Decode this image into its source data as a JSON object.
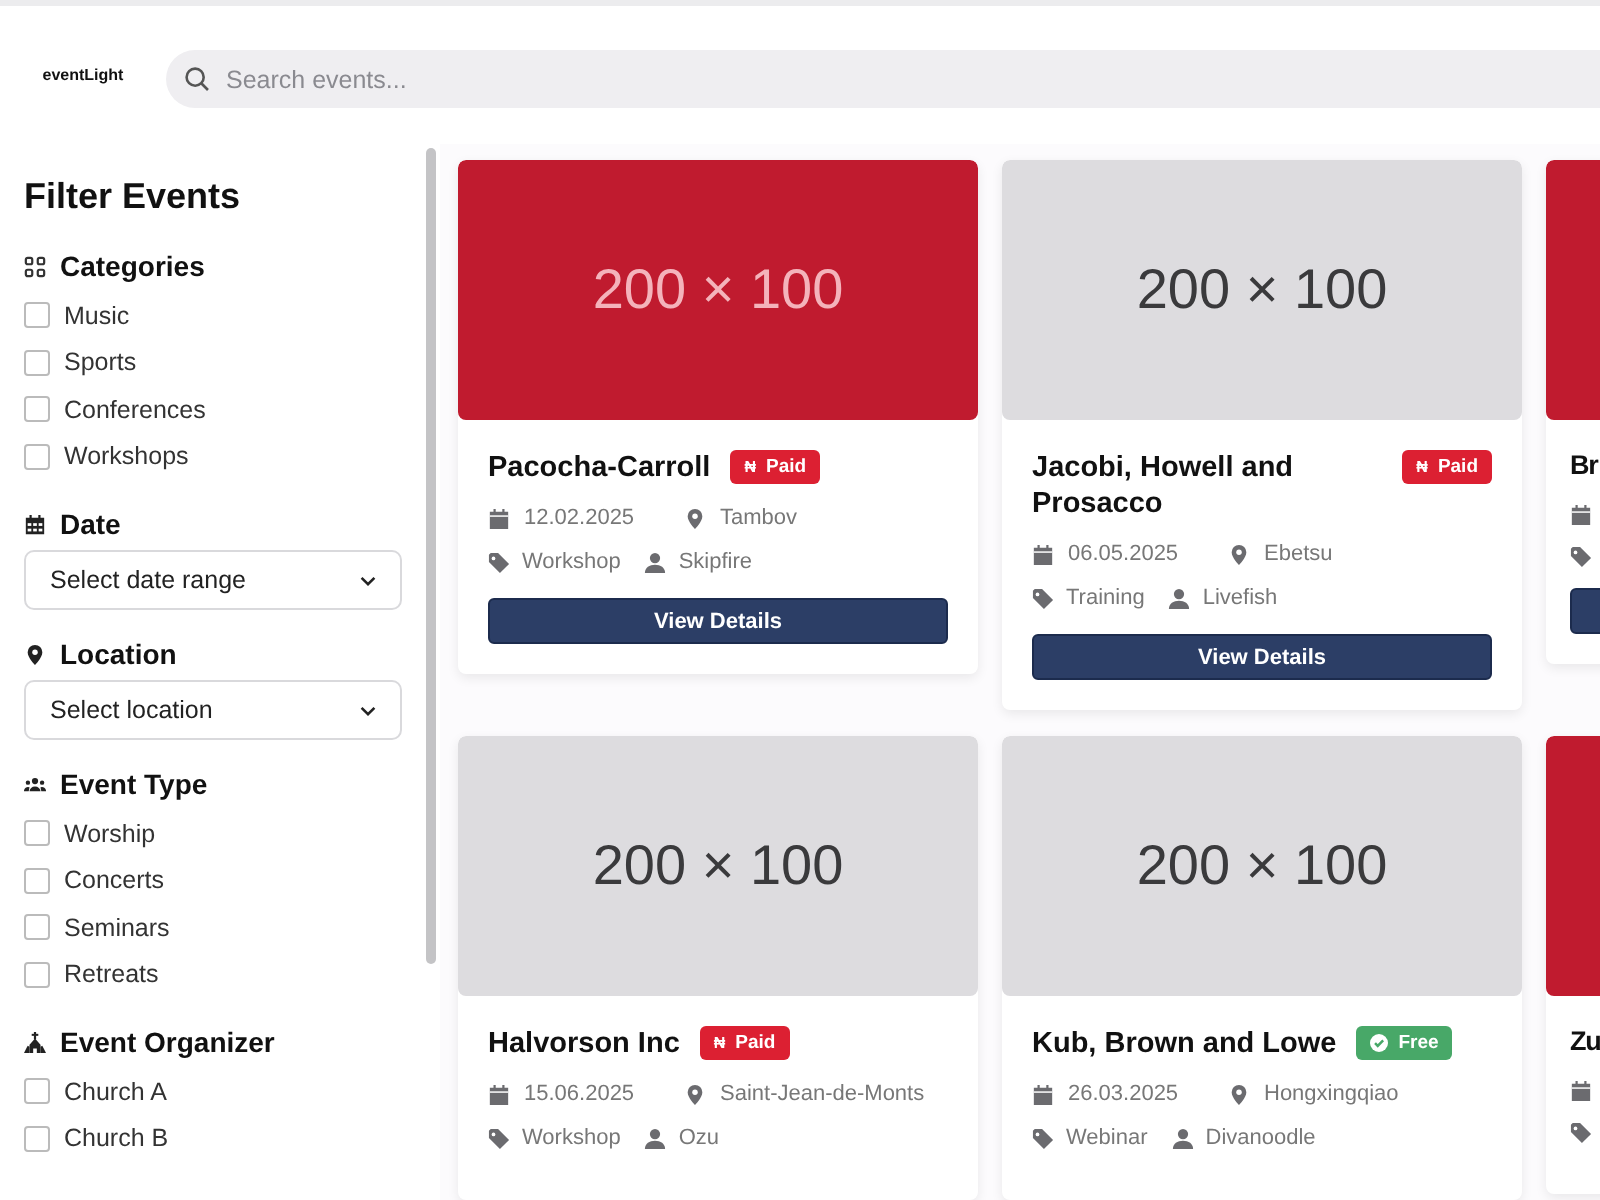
{
  "header": {
    "logo": "eventLight",
    "search": {
      "placeholder": "Search events..."
    }
  },
  "sidebar": {
    "title": "Filter Events",
    "sections": [
      {
        "kind": "checkboxes",
        "title": "Categories",
        "options": [
          {
            "label": "Music",
            "checked": false
          },
          {
            "label": "Sports",
            "checked": false
          },
          {
            "label": "Conferences",
            "checked": false
          },
          {
            "label": "Workshops",
            "checked": false
          }
        ]
      },
      {
        "kind": "select",
        "title": "Date",
        "placeholder": "Select date range"
      },
      {
        "kind": "select",
        "title": "Location",
        "placeholder": "Select location"
      },
      {
        "kind": "checkboxes",
        "title": "Event Type",
        "options": [
          {
            "label": "Worship",
            "checked": false
          },
          {
            "label": "Concerts",
            "checked": false
          },
          {
            "label": "Seminars",
            "checked": false
          },
          {
            "label": "Retreats",
            "checked": false
          }
        ]
      },
      {
        "kind": "checkboxes",
        "title": "Event Organizer",
        "options": [
          {
            "label": "Church A",
            "checked": false
          },
          {
            "label": "Church B",
            "checked": false
          }
        ]
      }
    ]
  },
  "events": [
    {
      "kind": "full",
      "image": {
        "label": "200 × 100",
        "color": "#c01b2f"
      },
      "title": "Pacocha-Carroll",
      "badge": {
        "kind": "paid",
        "symbol": "₦",
        "label": "Paid",
        "color": "#dc2032"
      },
      "date": "12.02.2025",
      "location": "Tambov",
      "type": "Workshop",
      "organizer": "Skipfire",
      "button": "View Details"
    },
    {
      "kind": "full",
      "image": {
        "label": "200 × 100",
        "color": "#dddcdf"
      },
      "title": "Jacobi, Howell and Prosacco",
      "badge": {
        "kind": "paid",
        "symbol": "₦",
        "label": "Paid",
        "color": "#dc2032"
      },
      "date": "06.05.2025",
      "location": "Ebetsu",
      "type": "Training",
      "organizer": "Livefish",
      "button": "View Details"
    },
    {
      "kind": "partial",
      "image": {
        "color": "#c01b2f"
      },
      "title": "Br",
      "button": true
    },
    {
      "kind": "full",
      "image": {
        "label": "200 × 100",
        "color": "#dddcdf"
      },
      "title": "Halvorson Inc",
      "badge": {
        "kind": "paid",
        "symbol": "₦",
        "label": "Paid",
        "color": "#dc2032"
      },
      "date": "15.06.2025",
      "location": "Saint-Jean-de-Monts",
      "type": "Workshop",
      "organizer": "Ozu"
    },
    {
      "kind": "full",
      "image": {
        "label": "200 × 100",
        "color": "#dddcdf"
      },
      "title": "Kub, Brown and Lowe",
      "badge": {
        "kind": "free",
        "label": "Free",
        "color": "#48a868"
      },
      "date": "26.03.2025",
      "location": "Hongxingqiao",
      "type": "Webinar",
      "organizer": "Divanoodle"
    },
    {
      "kind": "partial",
      "image": {
        "color": "#c01b2f"
      },
      "title": "Zu"
    }
  ]
}
